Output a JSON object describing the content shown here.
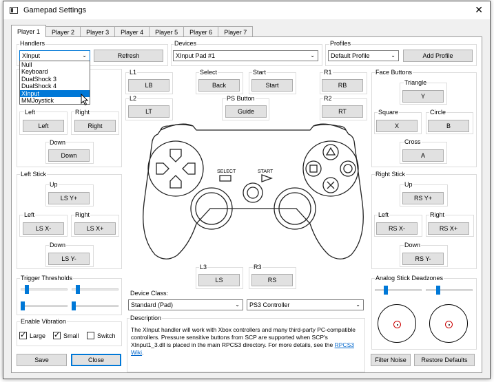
{
  "window": {
    "title": "Gamepad Settings",
    "close_glyph": "✕"
  },
  "tabs": [
    "Player 1",
    "Player 2",
    "Player 3",
    "Player 4",
    "Player 5",
    "Player 6",
    "Player 7"
  ],
  "handlers": {
    "label": "Handlers",
    "value": "XInput",
    "refresh": "Refresh",
    "options": [
      "Null",
      "Keyboard",
      "DualShock 3",
      "DualShock 4",
      "XInput",
      "MMJoystick"
    ],
    "selected_index": 4
  },
  "devices": {
    "label": "Devices",
    "value": "XInput Pad #1"
  },
  "profiles": {
    "label": "Profiles",
    "value": "Default Profile",
    "add": "Add Profile"
  },
  "dpad": {
    "left_label": "Left",
    "left": "Left",
    "right_label": "Right",
    "right": "Right",
    "down_label": "Down",
    "down": "Down"
  },
  "shoulders": {
    "l1_label": "L1",
    "l1": "LB",
    "l2_label": "L2",
    "l2": "LT",
    "r1_label": "R1",
    "r1": "RB",
    "r2_label": "R2",
    "r2": "RT"
  },
  "center": {
    "select_label": "Select",
    "select": "Back",
    "start_label": "Start",
    "start": "Start",
    "ps_label": "PS Button",
    "ps": "Guide"
  },
  "face": {
    "label": "Face Buttons",
    "triangle_label": "Triangle",
    "triangle": "Y",
    "square_label": "Square",
    "square": "X",
    "circle_label": "Circle",
    "circle": "B",
    "cross_label": "Cross",
    "cross": "A"
  },
  "left_stick": {
    "label": "Left Stick",
    "up_label": "Up",
    "up": "LS Y+",
    "left_label": "Left",
    "left": "LS X-",
    "right_label": "Right",
    "right": "LS X+",
    "down_label": "Down",
    "down": "LS Y-"
  },
  "right_stick": {
    "label": "Right Stick",
    "up_label": "Up",
    "up": "RS Y+",
    "left_label": "Left",
    "left": "RS X-",
    "right_label": "Right",
    "right": "RS X+",
    "down_label": "Down",
    "down": "RS Y-"
  },
  "sticks_click": {
    "l3_label": "L3",
    "l3": "LS",
    "r3_label": "R3",
    "r3": "RS"
  },
  "controller_image": {
    "select_text": "SELECT",
    "start_text": "START"
  },
  "trigger_thresholds": {
    "label": "Trigger Thresholds"
  },
  "vibration": {
    "label": "Enable Vibration",
    "large": "Large",
    "small": "Small",
    "switch": "Switch"
  },
  "device_class": {
    "label": "Device Class:",
    "value": "Standard (Pad)",
    "type": "PS3 Controller"
  },
  "description": {
    "label": "Description",
    "text": "The XInput handler will work with Xbox controllers and many third-party PC-compatible controllers. Pressure sensitive buttons from SCP are supported when SCP's XInput1_3.dll is placed in the main RPCS3 directory. For more details, see the",
    "link": "RPCS3 Wiki",
    "end": "."
  },
  "deadzones": {
    "label": "Analog Stick Deadzones"
  },
  "footer": {
    "save": "Save",
    "close": "Close",
    "filter_noise": "Filter Noise",
    "restore": "Restore Defaults"
  }
}
